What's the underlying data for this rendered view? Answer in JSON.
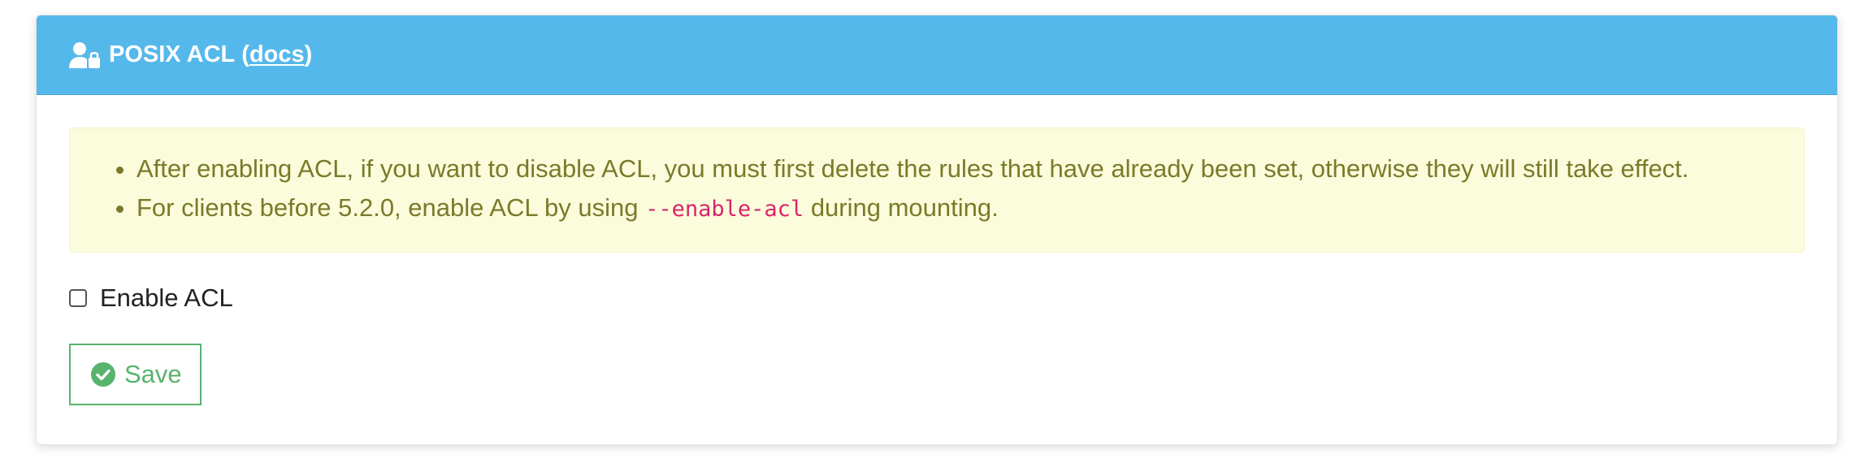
{
  "header": {
    "icon": "user-lock-icon",
    "title": "POSIX ACL",
    "open_paren": " (",
    "docs_label": "docs",
    "close_paren": ")"
  },
  "alert": {
    "item1": "After enabling ACL, if you want to disable ACL, you must first delete the rules that have already been set, otherwise they will still take effect.",
    "item2_prefix": "For clients before 5.2.0, enable ACL by using ",
    "item2_code": "--enable-acl",
    "item2_suffix": " during mounting."
  },
  "enable_acl": {
    "label": "Enable ACL",
    "checked": false
  },
  "save": {
    "icon": "check-circle-icon",
    "label": "Save"
  },
  "colors": {
    "header_bg": "#55b8ea",
    "alert_bg": "#fbfcdb",
    "alert_text": "#7a7a2a",
    "code_text": "#d9246b",
    "save_green": "#58b36d"
  }
}
